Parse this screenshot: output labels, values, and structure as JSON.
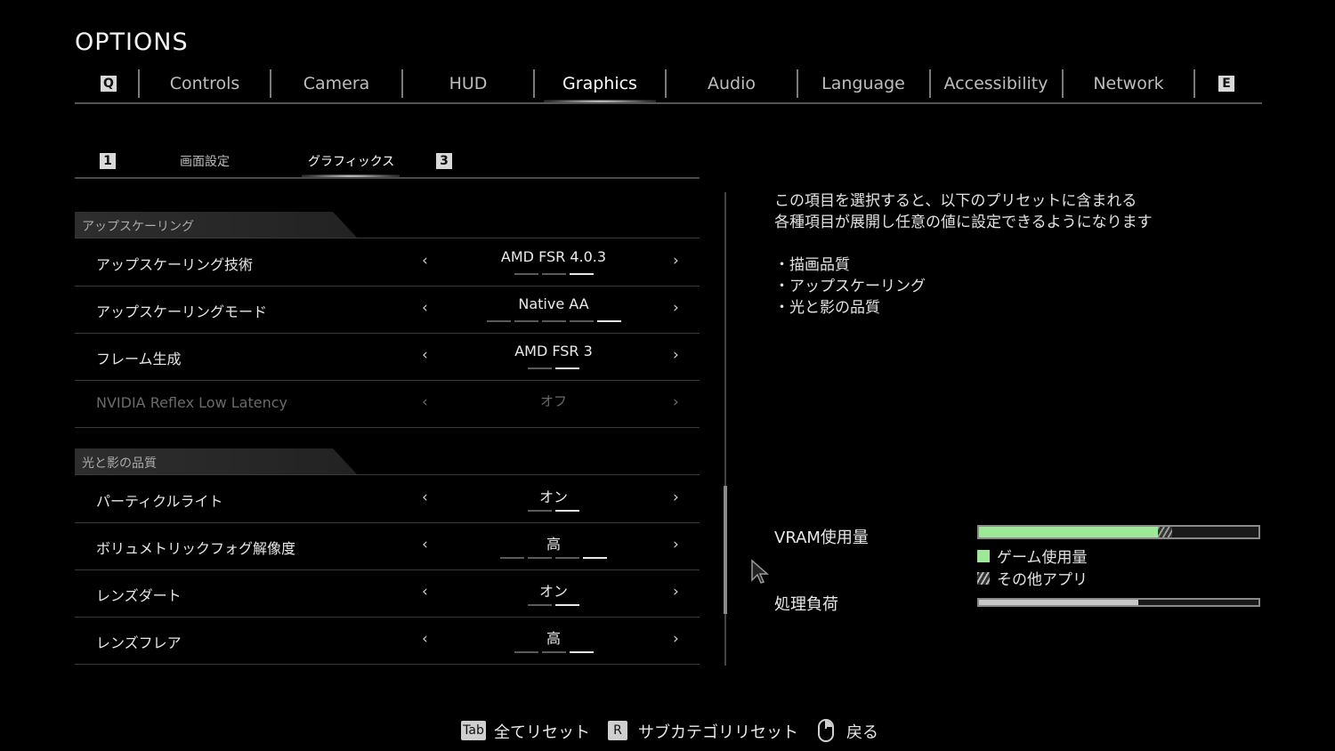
{
  "title": "OPTIONS",
  "top_tabs": {
    "left_key": "Q",
    "right_key": "E",
    "items": [
      {
        "label": "Controls"
      },
      {
        "label": "Camera"
      },
      {
        "label": "HUD"
      },
      {
        "label": "Graphics",
        "active": true
      },
      {
        "label": "Audio"
      },
      {
        "label": "Language"
      },
      {
        "label": "Accessibility"
      },
      {
        "label": "Network"
      }
    ]
  },
  "sub_tabs": {
    "left_key": "1",
    "right_key": "3",
    "items": [
      {
        "label": "画面設定"
      },
      {
        "label": "グラフィックス",
        "active": true
      }
    ]
  },
  "sections": [
    {
      "header": "アップスケーリング",
      "rows": [
        {
          "name": "アップスケーリング技術",
          "value": "AMD FSR 4.0.3",
          "level": 3,
          "steps": 3,
          "enabled": true
        },
        {
          "name": "アップスケーリングモード",
          "value": "Native AA",
          "level": 5,
          "steps": 5,
          "enabled": true
        },
        {
          "name": "フレーム生成",
          "value": "AMD FSR 3",
          "level": 2,
          "steps": 2,
          "enabled": true
        },
        {
          "name": "NVIDIA Reflex Low Latency",
          "value": "オフ",
          "level": 0,
          "steps": 0,
          "enabled": false
        }
      ]
    },
    {
      "header": "光と影の品質",
      "rows": [
        {
          "name": "パーティクルライト",
          "value": "オン",
          "level": 2,
          "steps": 2,
          "enabled": true
        },
        {
          "name": "ボリュメトリックフォグ解像度",
          "value": "高",
          "level": 4,
          "steps": 4,
          "enabled": true
        },
        {
          "name": "レンズダート",
          "value": "オン",
          "level": 2,
          "steps": 2,
          "enabled": true
        },
        {
          "name": "レンズフレア",
          "value": "高",
          "level": 3,
          "steps": 3,
          "enabled": true
        }
      ]
    }
  ],
  "description": {
    "line1": "この項目を選択すると、以下のプリセットに含まれる",
    "line2": "各種項目が展開し任意の値に設定できるようになります",
    "bullets": [
      "・描画品質",
      "・アップスケーリング",
      "・光と影の品質"
    ]
  },
  "meters": {
    "vram_label": "VRAM使用量",
    "vram_game_fraction": 0.64,
    "vram_other_fraction": 0.05,
    "legend_game": "ゲーム使用量",
    "legend_other": "その他アプリ",
    "load_label": "処理負荷",
    "load_fraction": 0.57,
    "game_color": "#9fe89a"
  },
  "footer": {
    "reset_all_key": "Tab",
    "reset_all_label": "全てリセット",
    "reset_sub_key": "R",
    "reset_sub_label": "サブカテゴリリセット",
    "back_label": "戻る"
  }
}
